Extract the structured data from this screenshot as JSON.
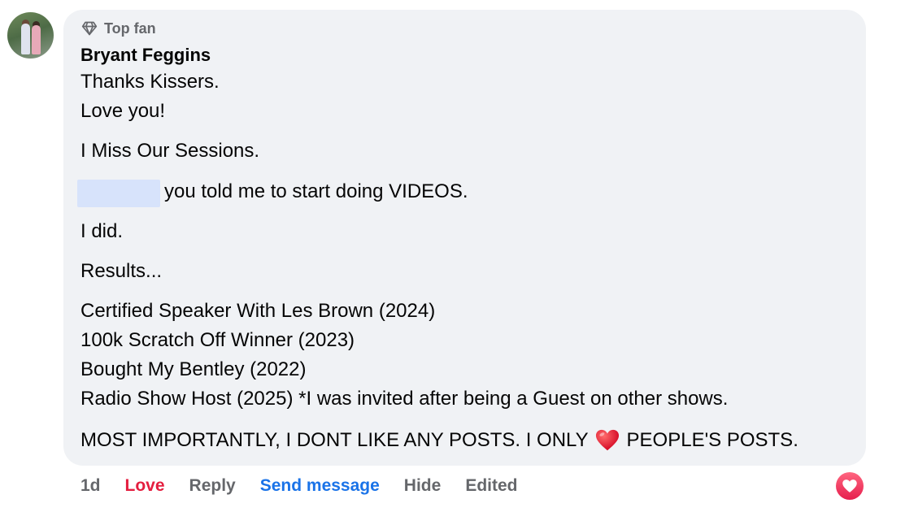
{
  "comment": {
    "badge_label": "Top fan",
    "author": "Bryant Feggins",
    "lines": {
      "l1": "Thanks Kissers.",
      "l2": "Love you!",
      "l3": "I Miss Our Sessions.",
      "l4": "you told me to start doing VIDEOS.",
      "l5": "I did.",
      "l6": "Results...",
      "l7": "Certified Speaker With Les Brown (2024)",
      "l8": "100k Scratch Off Winner (2023)",
      "l9": "Bought My Bentley (2022)",
      "l10": "Radio Show Host (2025) *I was invited after being a Guest on other shows.",
      "l11_before": "MOST IMPORTANTLY, I DONT LIKE ANY POSTS. I ONLY",
      "l11_after": "PEOPLE'S POSTS."
    }
  },
  "actions": {
    "time": "1d",
    "love": "Love",
    "reply": "Reply",
    "send_message": "Send message",
    "hide": "Hide",
    "edited": "Edited"
  },
  "colors": {
    "bubble": "#f0f2f5",
    "love": "#e41e3f",
    "link": "#1a73e8",
    "muted": "#65676b",
    "mention_highlight": "#d7e3fb"
  },
  "icons": {
    "badge": "diamond-icon",
    "emoji": "heart-emoji-icon",
    "reaction": "love-reaction-icon"
  }
}
